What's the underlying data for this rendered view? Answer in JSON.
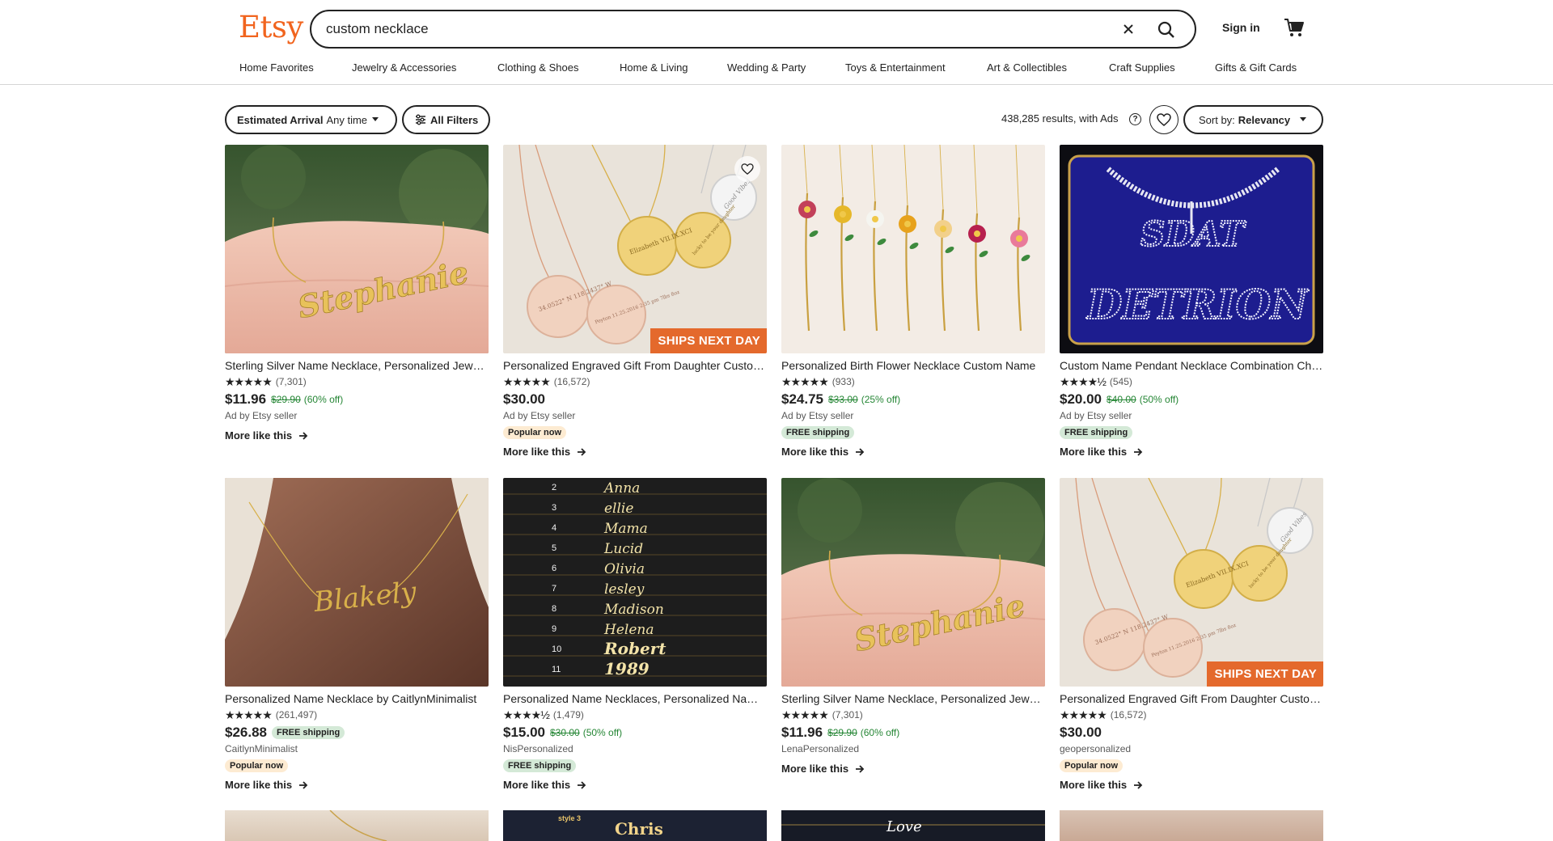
{
  "header": {
    "logo": "Etsy",
    "search_value": "custom necklace",
    "signin": "Sign in"
  },
  "nav": [
    "Home Favorites",
    "Jewelry & Accessories",
    "Clothing & Shoes",
    "Home & Living",
    "Wedding & Party",
    "Toys & Entertainment",
    "Art & Collectibles",
    "Craft Supplies",
    "Gifts & Gift Cards"
  ],
  "filters": {
    "arrival_label": "Estimated Arrival",
    "arrival_value": "Any time",
    "all_filters": "All Filters",
    "results": "438,285 results, with Ads",
    "help": "?",
    "sort_label": "Sort by:",
    "sort_value": "Relevancy"
  },
  "more_label": "More like this",
  "products": [
    {
      "title": "Sterling Silver Name Necklace, Personalized Jewelry",
      "reviews": "(7,301)",
      "stars": "★★★★★",
      "price": "$11.96",
      "orig": "$29.90",
      "disc": "(60% off)",
      "seller": "Ad by Etsy seller",
      "badge": "",
      "badge_type": "",
      "inline_badge": "",
      "overlay": "",
      "art": "Stephanie"
    },
    {
      "title": "Personalized Engraved Gift From Daughter Custom Necklace",
      "reviews": "(16,572)",
      "stars": "★★★★★",
      "price": "$30.00",
      "orig": "",
      "disc": "",
      "seller": "Ad by Etsy seller",
      "badge": "Popular now",
      "badge_type": "popular",
      "inline_badge": "",
      "overlay": "SHIPS NEXT DAY",
      "art": "discs"
    },
    {
      "title": "Personalized Birth Flower Necklace Custom Name",
      "reviews": "(933)",
      "stars": "★★★★★",
      "price": "$24.75",
      "orig": "$33.00",
      "disc": "(25% off)",
      "seller": "Ad by Etsy seller",
      "badge": "FREE shipping",
      "badge_type": "ship",
      "inline_badge": "",
      "overlay": "",
      "art": "flowers"
    },
    {
      "title": "Custom Name Pendant Necklace Combination Chain",
      "reviews": "(545)",
      "stars": "★★★★½",
      "price": "$20.00",
      "orig": "$40.00",
      "disc": "(50% off)",
      "seller": "Ad by Etsy seller",
      "badge": "FREE shipping",
      "badge_type": "ship",
      "inline_badge": "",
      "overlay": "",
      "art": "iced"
    },
    {
      "title": "Personalized Name Necklace by CaitlynMinimalist",
      "reviews": "(261,497)",
      "stars": "★★★★★",
      "price": "$26.88",
      "orig": "",
      "disc": "",
      "seller": "CaitlynMinimalist",
      "badge": "Popular now",
      "badge_type": "popular",
      "inline_badge": "FREE shipping",
      "overlay": "",
      "art": "Blakely"
    },
    {
      "title": "Personalized Name Necklaces, Personalized Name Jewelry",
      "reviews": "(1,479)",
      "stars": "★★★★½",
      "price": "$15.00",
      "orig": "$30.00",
      "disc": "(50% off)",
      "seller": "NisPersonalized",
      "badge": "FREE shipping",
      "badge_type": "ship",
      "inline_badge": "",
      "overlay": "",
      "art": "styles"
    },
    {
      "title": "Sterling Silver Name Necklace, Personalized Jewelry",
      "reviews": "(7,301)",
      "stars": "★★★★★",
      "price": "$11.96",
      "orig": "$29.90",
      "disc": "(60% off)",
      "seller": "LenaPersonalized",
      "badge": "",
      "badge_type": "",
      "inline_badge": "",
      "overlay": "",
      "art": "Stephanie"
    },
    {
      "title": "Personalized Engraved Gift From Daughter Custom Necklace",
      "reviews": "(16,572)",
      "stars": "★★★★★",
      "price": "$30.00",
      "orig": "",
      "disc": "",
      "seller": "geopersonalized",
      "badge": "Popular now",
      "badge_type": "popular",
      "inline_badge": "",
      "overlay": "SHIPS NEXT DAY",
      "art": "discs"
    }
  ],
  "image_text": {
    "stephanie": "Stephanie",
    "blakely": "Blakely",
    "sdat": "SDAT",
    "detrion": "DETRION",
    "disc1": "34.0522° N 118.2437° W",
    "disc2": "Peyton 11.25.2016 2:35 pm 7lbs 8oz",
    "disc3": "Elizabeth VII.IX.XCI",
    "disc4": "lucky to be your daughter",
    "disc5": "Good Vibes",
    "style_nums": [
      "2",
      "3",
      "4",
      "5",
      "6",
      "7",
      "8",
      "9",
      "10",
      "11"
    ],
    "style_names": [
      "Anna",
      "ellie",
      "Mama",
      "Lucid",
      "Olivia",
      "lesley",
      "Madison",
      "Helena",
      "Robert",
      "1989"
    ],
    "row3_style": "style 3",
    "row3_chris": "Chris",
    "row3_love": "Love"
  },
  "colors": {
    "brand": "#f1641e",
    "sale": "#258635",
    "ships_next_day": "#e4692c"
  }
}
